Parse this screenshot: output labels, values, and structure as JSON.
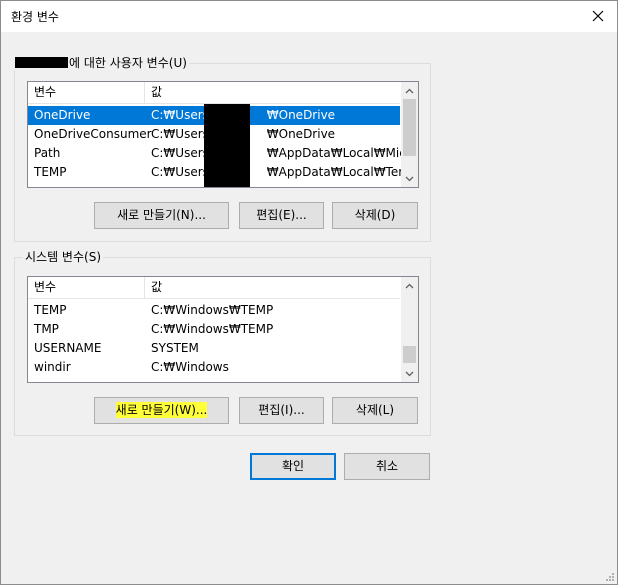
{
  "window": {
    "title": "환경 변수",
    "close_glyph": "✕"
  },
  "user_vars": {
    "group_label": "에 대한 사용자 변수(U)",
    "headers": [
      "변수",
      "값"
    ],
    "rows": [
      {
        "name": "OneDrive",
        "value_prefix": "C:₩Users₩",
        "value_suffix": "₩OneDrive",
        "selected": true
      },
      {
        "name": "OneDriveConsumer",
        "value_prefix": "C:₩Users₩",
        "value_suffix": "₩OneDrive",
        "selected": false
      },
      {
        "name": "Path",
        "value_prefix": "C:₩Users₩",
        "value_suffix": "₩AppData₩Local₩Micro...",
        "selected": false
      },
      {
        "name": "TEMP",
        "value_prefix": "C:₩Users₩",
        "value_suffix": "₩AppData₩Local₩Temp",
        "selected": false
      }
    ],
    "new_button": "새로 만들기(N)...",
    "edit_button": "편집(E)...",
    "delete_button": "삭제(D)"
  },
  "system_vars": {
    "group_label": "시스템 변수(S)",
    "headers": [
      "변수",
      "값"
    ],
    "rows": [
      {
        "name": "TEMP",
        "value": "C:₩Windows₩TEMP"
      },
      {
        "name": "TMP",
        "value": "C:₩Windows₩TEMP"
      },
      {
        "name": "USERNAME",
        "value": "SYSTEM"
      },
      {
        "name": "windir",
        "value": "C:₩Windows"
      }
    ],
    "new_button": "새로 만들기(W)...",
    "edit_button": "편집(I)...",
    "delete_button": "삭제(L)"
  },
  "footer": {
    "ok_button": "확인",
    "cancel_button": "취소"
  },
  "colors": {
    "selection": "#0078d7",
    "highlight": "#ffff3a"
  }
}
